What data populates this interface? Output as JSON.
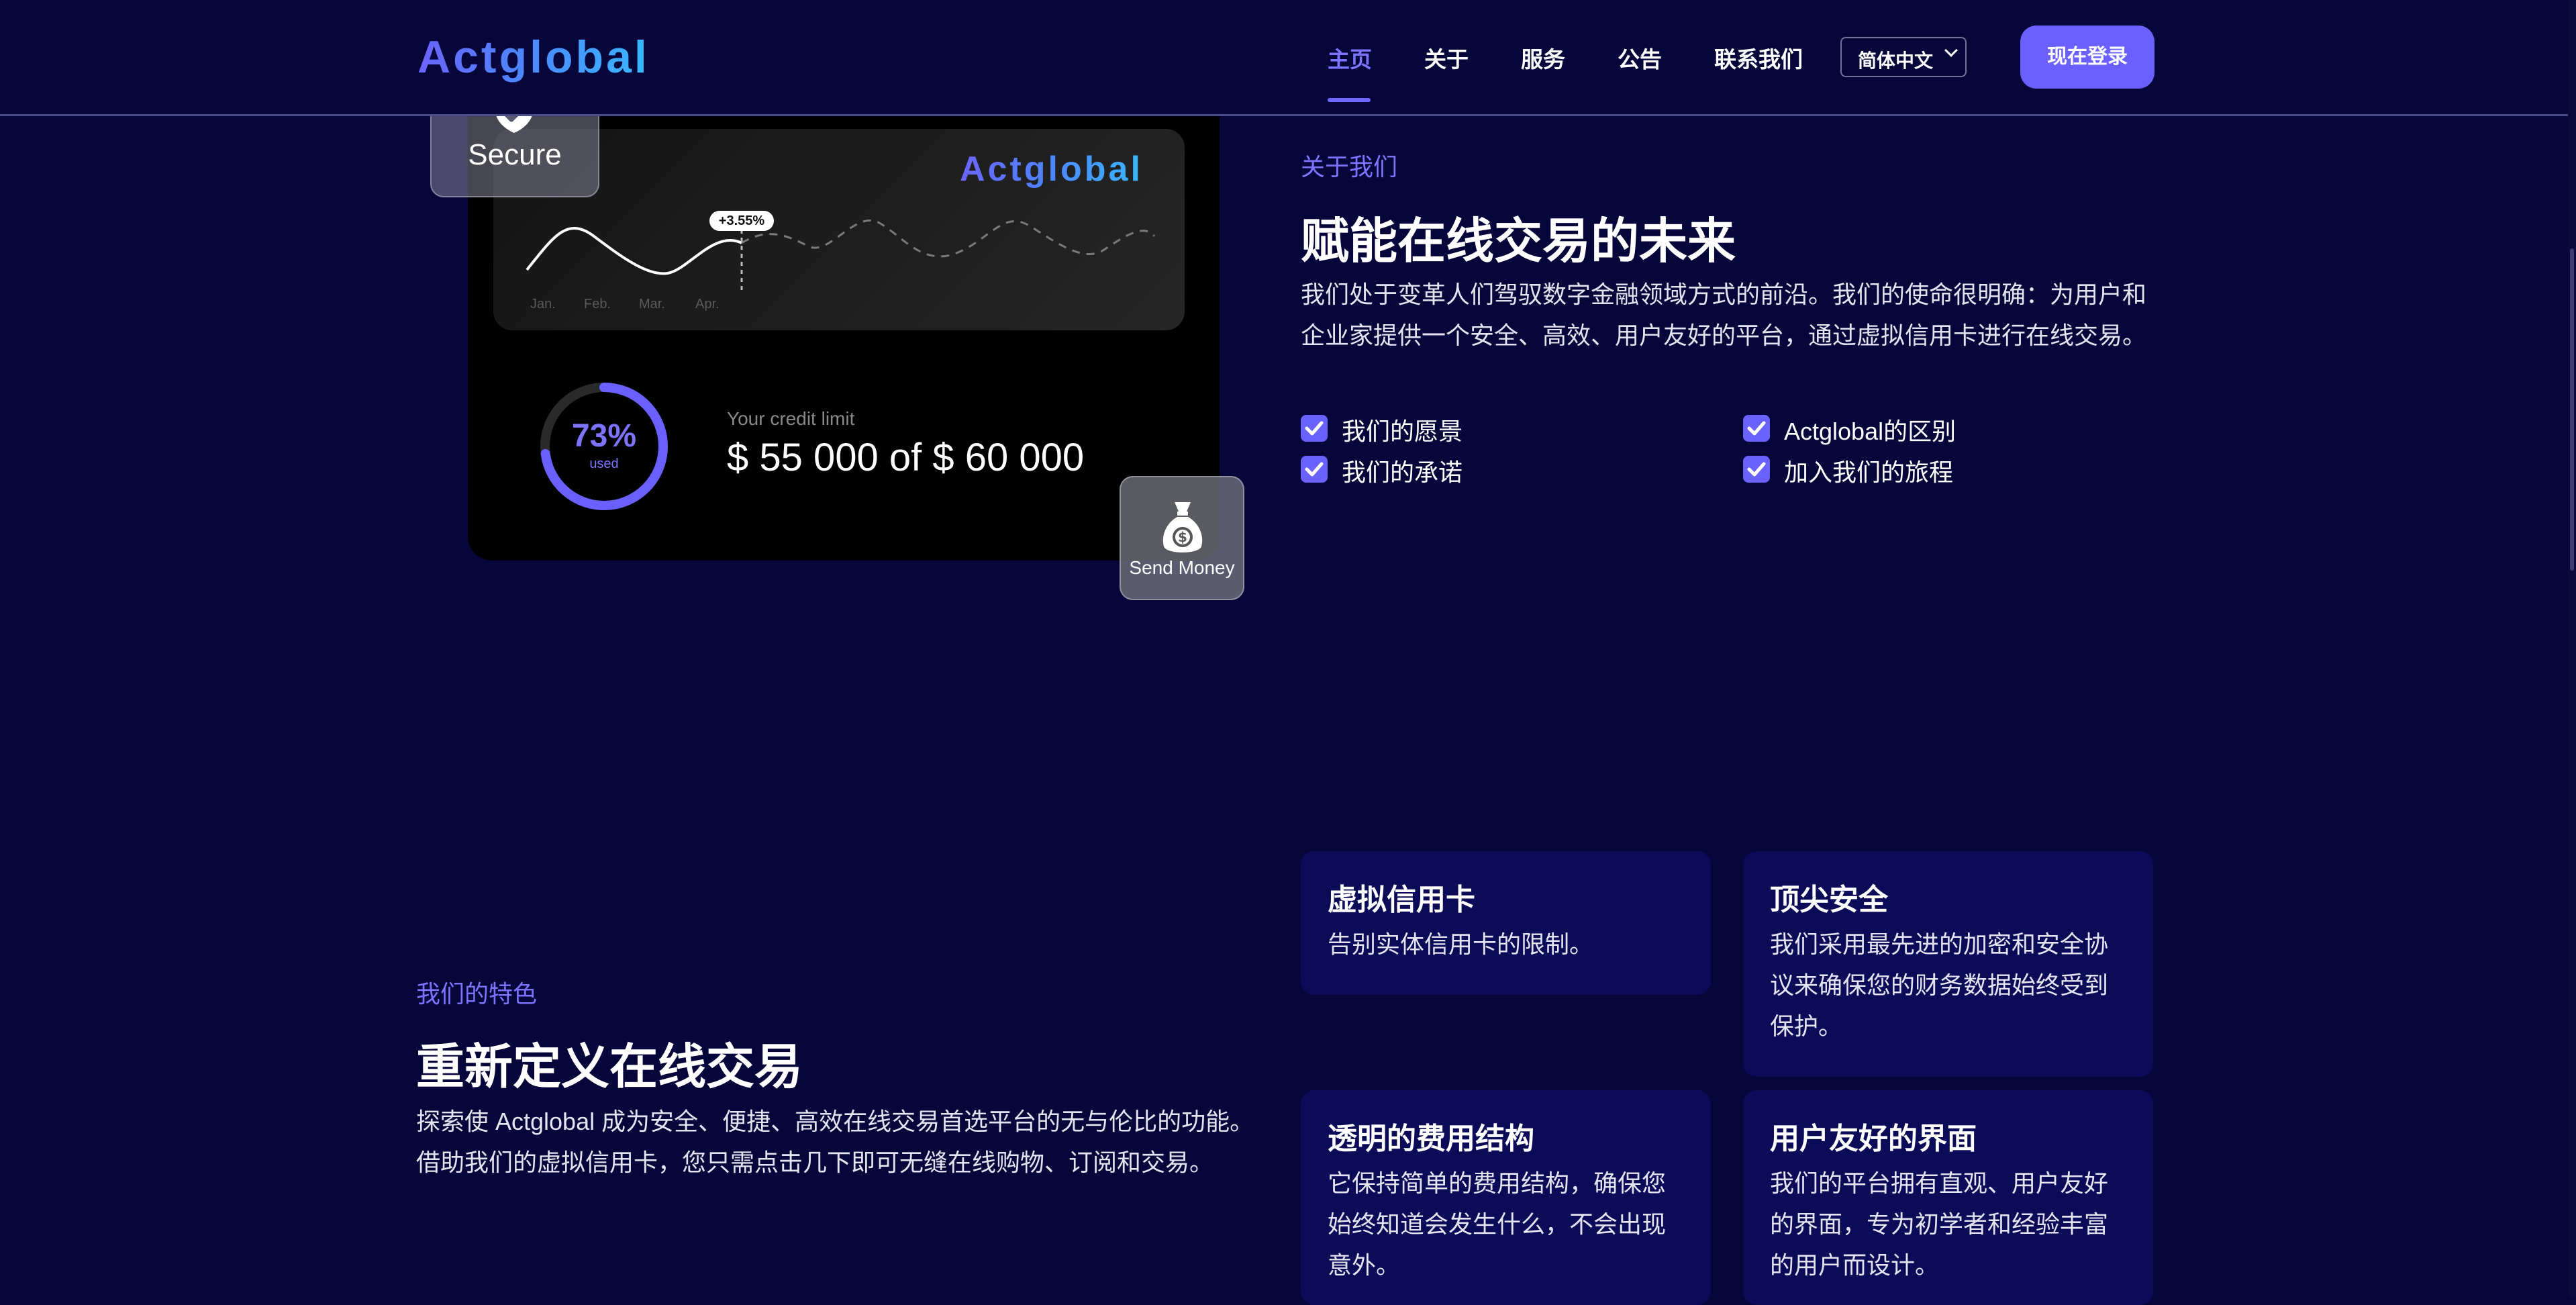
{
  "header": {
    "logo": "Actglobal",
    "nav": [
      {
        "label": "主页",
        "active": true
      },
      {
        "label": "关于",
        "active": false
      },
      {
        "label": "服务",
        "active": false
      },
      {
        "label": "公告",
        "active": false
      },
      {
        "label": "联系我们",
        "active": false
      }
    ],
    "language": "简体中文",
    "login_label": "现在登录"
  },
  "hero_card": {
    "brand": "Actglobal",
    "change_pill": "+3.55%",
    "months": [
      "Jan.",
      "Feb.",
      "Mar.",
      "Apr."
    ],
    "usage_percent": "73%",
    "usage_fraction": 0.73,
    "usage_caption": "used",
    "limit_label": "Your credit limit",
    "limit_value": "$ 55 000 of $ 60 000",
    "secure_label": "Secure",
    "send_label": "Send Money"
  },
  "about": {
    "eyebrow": "关于我们",
    "title": "赋能在线交易的未来",
    "paragraph_lines": [
      "我们处于变革人们驾驭数字金融领域方式的前沿。我们的使命很明确：为用户和",
      "企业家提供一个安全、高效、用户友好的平台，通过虚拟信用卡进行在线交易。"
    ],
    "checklist": [
      "我们的愿景",
      "Actglobal的区别",
      "我们的承诺",
      "加入我们的旅程"
    ]
  },
  "features": {
    "eyebrow": "我们的特色",
    "title": "重新定义在线交易",
    "paragraph_lines": [
      "探索使 Actglobal 成为安全、便捷、高效在线交易首选平台的无与伦比的功能。",
      "借助我们的虚拟信用卡，您只需点击几下即可无缝在线购物、订阅和交易。"
    ],
    "cards": [
      {
        "title": "虚拟信用卡",
        "lines": [
          "告别实体信用卡的限制。"
        ]
      },
      {
        "title": "顶尖安全",
        "lines": [
          "我们采用最先进的加密和安全协",
          "议来确保您的财务数据始终受到",
          "保护。"
        ]
      },
      {
        "title": "透明的费用结构",
        "lines": [
          "它保持简单的费用结构，确保您",
          "始终知道会发生什么，不会出现",
          "意外。"
        ]
      },
      {
        "title": "用户友好的界面",
        "lines": [
          "我们的平台拥有直观、用户友好",
          "的界面，专为初学者和经验丰富",
          "的用户而设计。"
        ]
      }
    ]
  },
  "colors": {
    "background": "#07063a",
    "accent": "#6a60ff",
    "card_bg": "#0b0b58"
  }
}
